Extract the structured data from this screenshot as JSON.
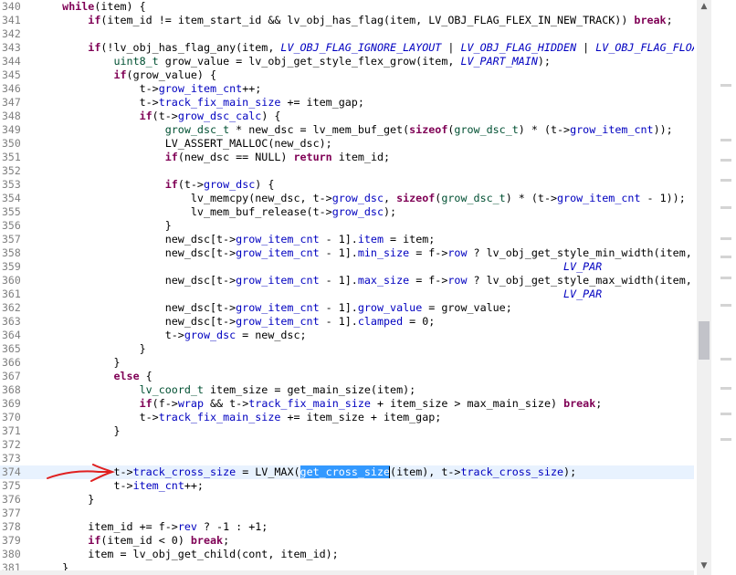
{
  "editor": {
    "lines": [
      {
        "n": "340",
        "html": "    <span class=\"k\">while</span>(item) {"
      },
      {
        "n": "341",
        "html": "        <span class=\"k\">if</span>(item_id != item_start_id &amp;&amp; lv_obj_has_flag(item, LV_OBJ_FLAG_FLEX_IN_NEW_TRACK)) <span class=\"k\">break</span>;"
      },
      {
        "n": "342",
        "html": ""
      },
      {
        "n": "343",
        "html": "        <span class=\"k\">if</span>(!lv_obj_has_flag_any(item, <span class=\"i\">LV_OBJ_FLAG_IGNORE_LAYOUT</span> | <span class=\"i\">LV_OBJ_FLAG_HIDDEN</span> | <span class=\"i\">LV_OBJ_FLAG_FLOA</span>"
      },
      {
        "n": "344",
        "html": "            <span class=\"t\">uint8_t</span> grow_value = lv_obj_get_style_flex_grow(item, <span class=\"i\">LV_PART_MAIN</span>);"
      },
      {
        "n": "345",
        "html": "            <span class=\"k\">if</span>(grow_value) {"
      },
      {
        "n": "346",
        "html": "                t-&gt;<span class=\"f\">grow_item_cnt</span>++;"
      },
      {
        "n": "347",
        "html": "                t-&gt;<span class=\"f\">track_fix_main_size</span> += item_gap;"
      },
      {
        "n": "348",
        "html": "                <span class=\"k\">if</span>(t-&gt;<span class=\"f\">grow_dsc_calc</span>) {"
      },
      {
        "n": "349",
        "html": "                    <span class=\"t\">grow_dsc_t</span> * new_dsc = lv_mem_buf_get(<span class=\"k\">sizeof</span>(<span class=\"t\">grow_dsc_t</span>) * (t-&gt;<span class=\"f\">grow_item_cnt</span>));"
      },
      {
        "n": "350",
        "html": "                    LV_ASSERT_MALLOC(new_dsc);"
      },
      {
        "n": "351",
        "html": "                    <span class=\"k\">if</span>(new_dsc == NULL) <span class=\"k\">return</span> item_id;"
      },
      {
        "n": "352",
        "html": ""
      },
      {
        "n": "353",
        "html": "                    <span class=\"k\">if</span>(t-&gt;<span class=\"f\">grow_dsc</span>) {"
      },
      {
        "n": "354",
        "html": "                        lv_memcpy(new_dsc, t-&gt;<span class=\"f\">grow_dsc</span>, <span class=\"k\">sizeof</span>(<span class=\"t\">grow_dsc_t</span>) * (t-&gt;<span class=\"f\">grow_item_cnt</span> - 1));"
      },
      {
        "n": "355",
        "html": "                        lv_mem_buf_release(t-&gt;<span class=\"f\">grow_dsc</span>);"
      },
      {
        "n": "356",
        "html": "                    }"
      },
      {
        "n": "357",
        "html": "                    new_dsc[t-&gt;<span class=\"f\">grow_item_cnt</span> - 1].<span class=\"f\">item</span> = item;"
      },
      {
        "n": "358",
        "html": "                    new_dsc[t-&gt;<span class=\"f\">grow_item_cnt</span> - 1].<span class=\"f\">min_size</span> = f-&gt;<span class=\"f\">row</span> ? lv_obj_get_style_min_width(item,"
      },
      {
        "n": "359",
        "html": "                                                                                  <span class=\"i\">LV_PAR</span>"
      },
      {
        "n": "360",
        "html": "                    new_dsc[t-&gt;<span class=\"f\">grow_item_cnt</span> - 1].<span class=\"f\">max_size</span> = f-&gt;<span class=\"f\">row</span> ? lv_obj_get_style_max_width(item,"
      },
      {
        "n": "361",
        "html": "                                                                                  <span class=\"i\">LV_PAR</span>"
      },
      {
        "n": "362",
        "html": "                    new_dsc[t-&gt;<span class=\"f\">grow_item_cnt</span> - 1].<span class=\"f\">grow_value</span> = grow_value;"
      },
      {
        "n": "363",
        "html": "                    new_dsc[t-&gt;<span class=\"f\">grow_item_cnt</span> - 1].<span class=\"f\">clamped</span> = 0;"
      },
      {
        "n": "364",
        "html": "                    t-&gt;<span class=\"f\">grow_dsc</span> = new_dsc;"
      },
      {
        "n": "365",
        "html": "                }"
      },
      {
        "n": "366",
        "html": "            }"
      },
      {
        "n": "367",
        "html": "            <span class=\"k\">else</span> {"
      },
      {
        "n": "368",
        "html": "                <span class=\"t\">lv_coord_t</span> item_size = get_main_size(item);"
      },
      {
        "n": "369",
        "html": "                <span class=\"k\">if</span>(f-&gt;<span class=\"f\">wrap</span> &amp;&amp; t-&gt;<span class=\"f\">track_fix_main_size</span> + item_size &gt; max_main_size) <span class=\"k\">break</span>;"
      },
      {
        "n": "370",
        "html": "                t-&gt;<span class=\"f\">track_fix_main_size</span> += item_size + item_gap;"
      },
      {
        "n": "371",
        "html": "            }"
      },
      {
        "n": "372",
        "html": ""
      },
      {
        "n": "373",
        "html": ""
      },
      {
        "n": "374",
        "html": "            t-&gt;<span class=\"f\">track_cross_size</span> = LV_MAX(<span class=\"sel\">get_cross_size</span><span class=\"caret\"></span>(item), t-&gt;<span class=\"f\">track_cross_size</span>);",
        "current": true
      },
      {
        "n": "375",
        "html": "            t-&gt;<span class=\"f\">item_cnt</span>++;"
      },
      {
        "n": "376",
        "html": "        }"
      },
      {
        "n": "377",
        "html": ""
      },
      {
        "n": "378",
        "html": "        item_id += f-&gt;<span class=\"f\">rev</span> ? -1 : +1;"
      },
      {
        "n": "379",
        "html": "        <span class=\"k\">if</span>(item_id &lt; 0) <span class=\"k\">break</span>;"
      },
      {
        "n": "380",
        "html": "        item = lv_obj_get_child(cont, item_id);"
      },
      {
        "n": "381",
        "html": "    }"
      }
    ]
  },
  "annotation": {
    "color": "#e02020",
    "meaning": "red arrow pointing at line 374"
  },
  "scrollbar": {
    "up_glyph": "▲",
    "down_glyph": "▼",
    "thumb_color": "#c2c3c9"
  },
  "colors": {
    "keyword": "#7f0055",
    "field": "#0000c0",
    "type": "#005032",
    "macro": "#0000c0",
    "selection": "#3399ff",
    "current_line": "#e8f2fe"
  }
}
